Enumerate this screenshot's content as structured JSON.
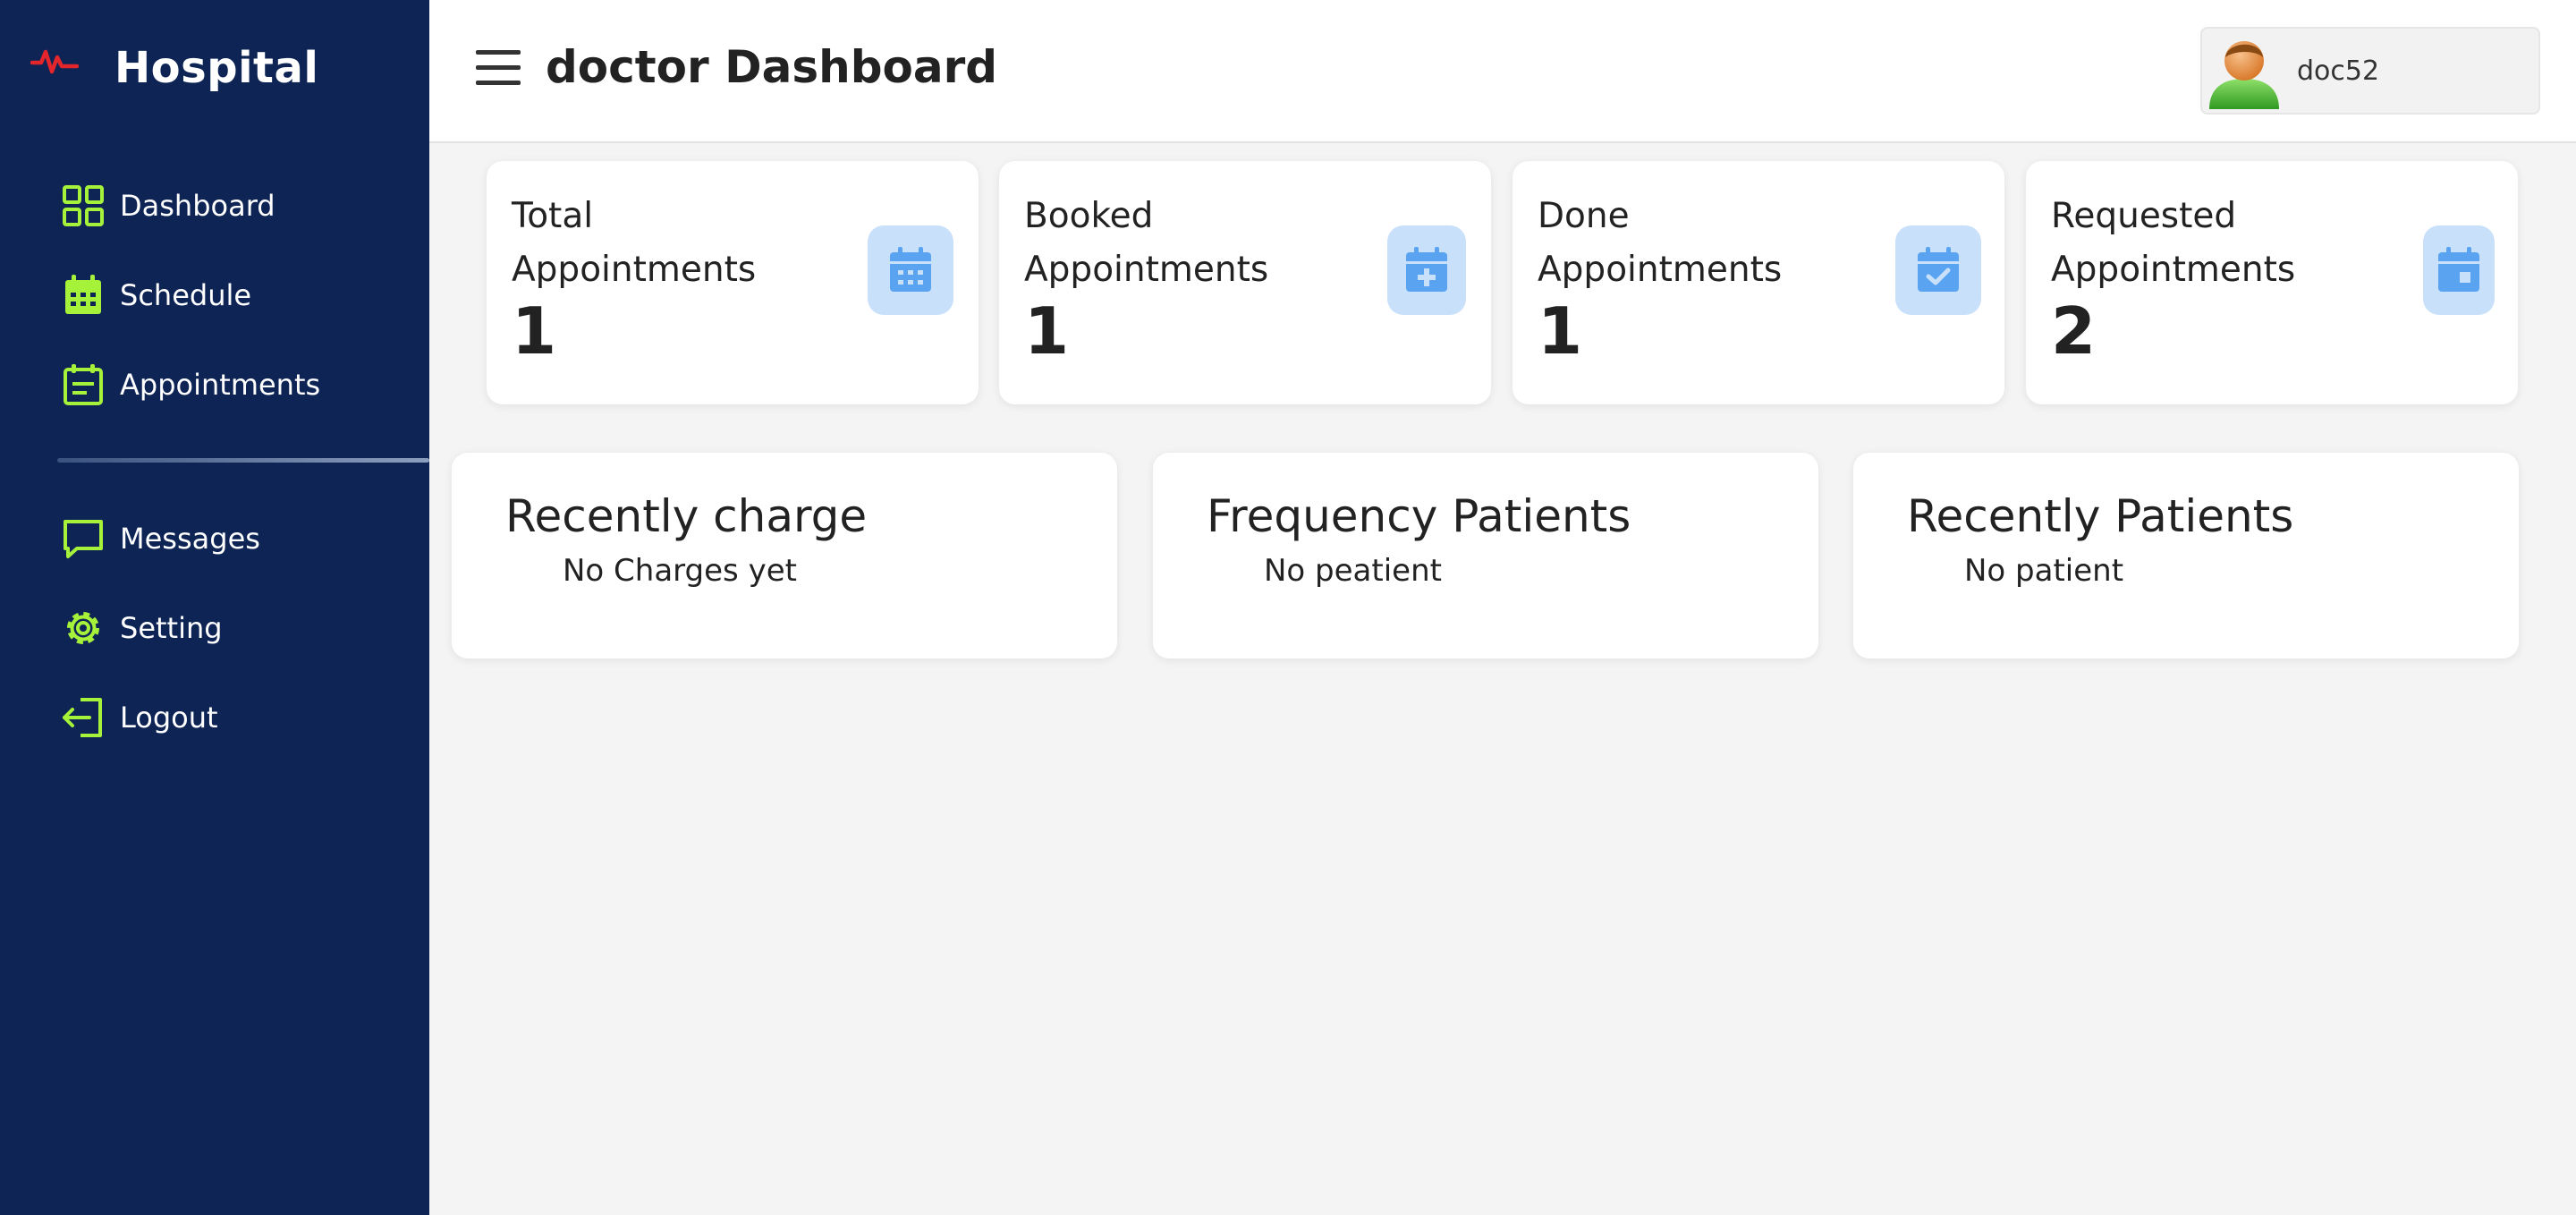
{
  "app": {
    "brand": "Hospital",
    "brand_icon": "heartbeat-icon",
    "accent_color": "#a6f23a",
    "sidebar_color": "#0d2455",
    "brand_icon_color": "#e3262b"
  },
  "sidebar": {
    "items": [
      {
        "label": "Dashboard",
        "icon": "dashboard-grid-icon"
      },
      {
        "label": "Schedule",
        "icon": "calendar-icon"
      },
      {
        "label": "Appointments",
        "icon": "appointment-list-icon"
      },
      {
        "label": "Messages",
        "icon": "message-icon"
      },
      {
        "label": "Setting",
        "icon": "gear-icon"
      },
      {
        "label": "Logout",
        "icon": "logout-icon"
      }
    ]
  },
  "header": {
    "title": "doctor Dashboard",
    "menu_icon": "hamburger-menu-icon",
    "user": {
      "name": "doc52",
      "avatar": "user-avatar-icon"
    }
  },
  "stats": [
    {
      "title": "Total Appointments",
      "value": "1",
      "icon": "calendar-grid-icon"
    },
    {
      "title": "Booked Appointments",
      "value": "1",
      "icon": "calendar-plus-icon"
    },
    {
      "title": "Done Appointments",
      "value": "1",
      "icon": "calendar-check-icon"
    },
    {
      "title": "Requested Appointments",
      "value": "2",
      "icon": "calendar-day-icon"
    }
  ],
  "panels": [
    {
      "title": "Recently charge",
      "empty": "No Charges yet"
    },
    {
      "title": "Frequency Patients",
      "empty": "No peatient"
    },
    {
      "title": "Recently Patients",
      "empty": "No patient"
    }
  ]
}
